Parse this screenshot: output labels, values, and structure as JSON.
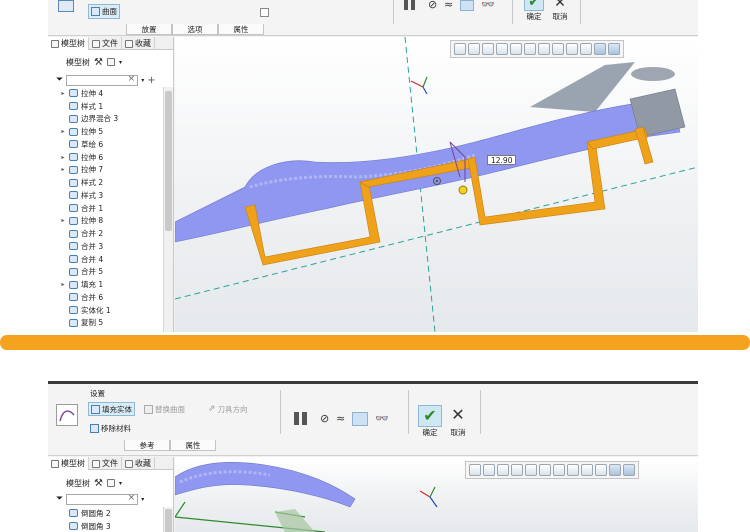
{
  "top": {
    "ribbon": {
      "surface_btn": "曲面",
      "tabs": [
        "放置",
        "选项",
        "属性"
      ],
      "confirm": "确定",
      "cancel": "取消"
    },
    "tree": {
      "tabs": [
        "模型树",
        "文件",
        "收藏"
      ],
      "toolbar_label": "模型树",
      "filter_placeholder": "",
      "items": [
        {
          "label": "拉伸 4",
          "expand": "▸"
        },
        {
          "label": "样式 1",
          "expand": ""
        },
        {
          "label": "边界混合 3",
          "expand": ""
        },
        {
          "label": "拉伸 5",
          "expand": "▸"
        },
        {
          "label": "草绘 6",
          "expand": ""
        },
        {
          "label": "拉伸 6",
          "expand": "▸"
        },
        {
          "label": "拉伸 7",
          "expand": "▸"
        },
        {
          "label": "样式 2",
          "expand": ""
        },
        {
          "label": "样式 3",
          "expand": ""
        },
        {
          "label": "合并 1",
          "expand": ""
        },
        {
          "label": "拉伸 8",
          "expand": "▸"
        },
        {
          "label": "合并 2",
          "expand": ""
        },
        {
          "label": "合并 3",
          "expand": ""
        },
        {
          "label": "合并 4",
          "expand": ""
        },
        {
          "label": "合并 5",
          "expand": ""
        },
        {
          "label": "填充 1",
          "expand": "▸"
        },
        {
          "label": "合并 6",
          "expand": ""
        },
        {
          "label": "实体化 1",
          "expand": ""
        },
        {
          "label": "复制 5",
          "expand": ""
        }
      ]
    },
    "viewport": {
      "dimension": "12.90"
    }
  },
  "bottom": {
    "ribbon": {
      "group_label": "设置",
      "fill_solid": "填充实体",
      "replace_surface": "替换曲面",
      "tool_direction": "刀具方向",
      "remove_material": "移除材料",
      "tabs": [
        "参考",
        "属性"
      ],
      "confirm": "确定",
      "cancel": "取消"
    },
    "tree": {
      "tabs": [
        "模型树",
        "文件",
        "收藏"
      ],
      "toolbar_label": "模型树",
      "items": [
        {
          "label": "倒圆角 2",
          "expand": ""
        },
        {
          "label": "倒圆角 3",
          "expand": ""
        }
      ]
    }
  },
  "colors": {
    "divider": "#f5a31f",
    "sketch_orange": "#f0a11a",
    "body_blue": "#8f97f0",
    "axis_teal": "#2aa39a"
  }
}
